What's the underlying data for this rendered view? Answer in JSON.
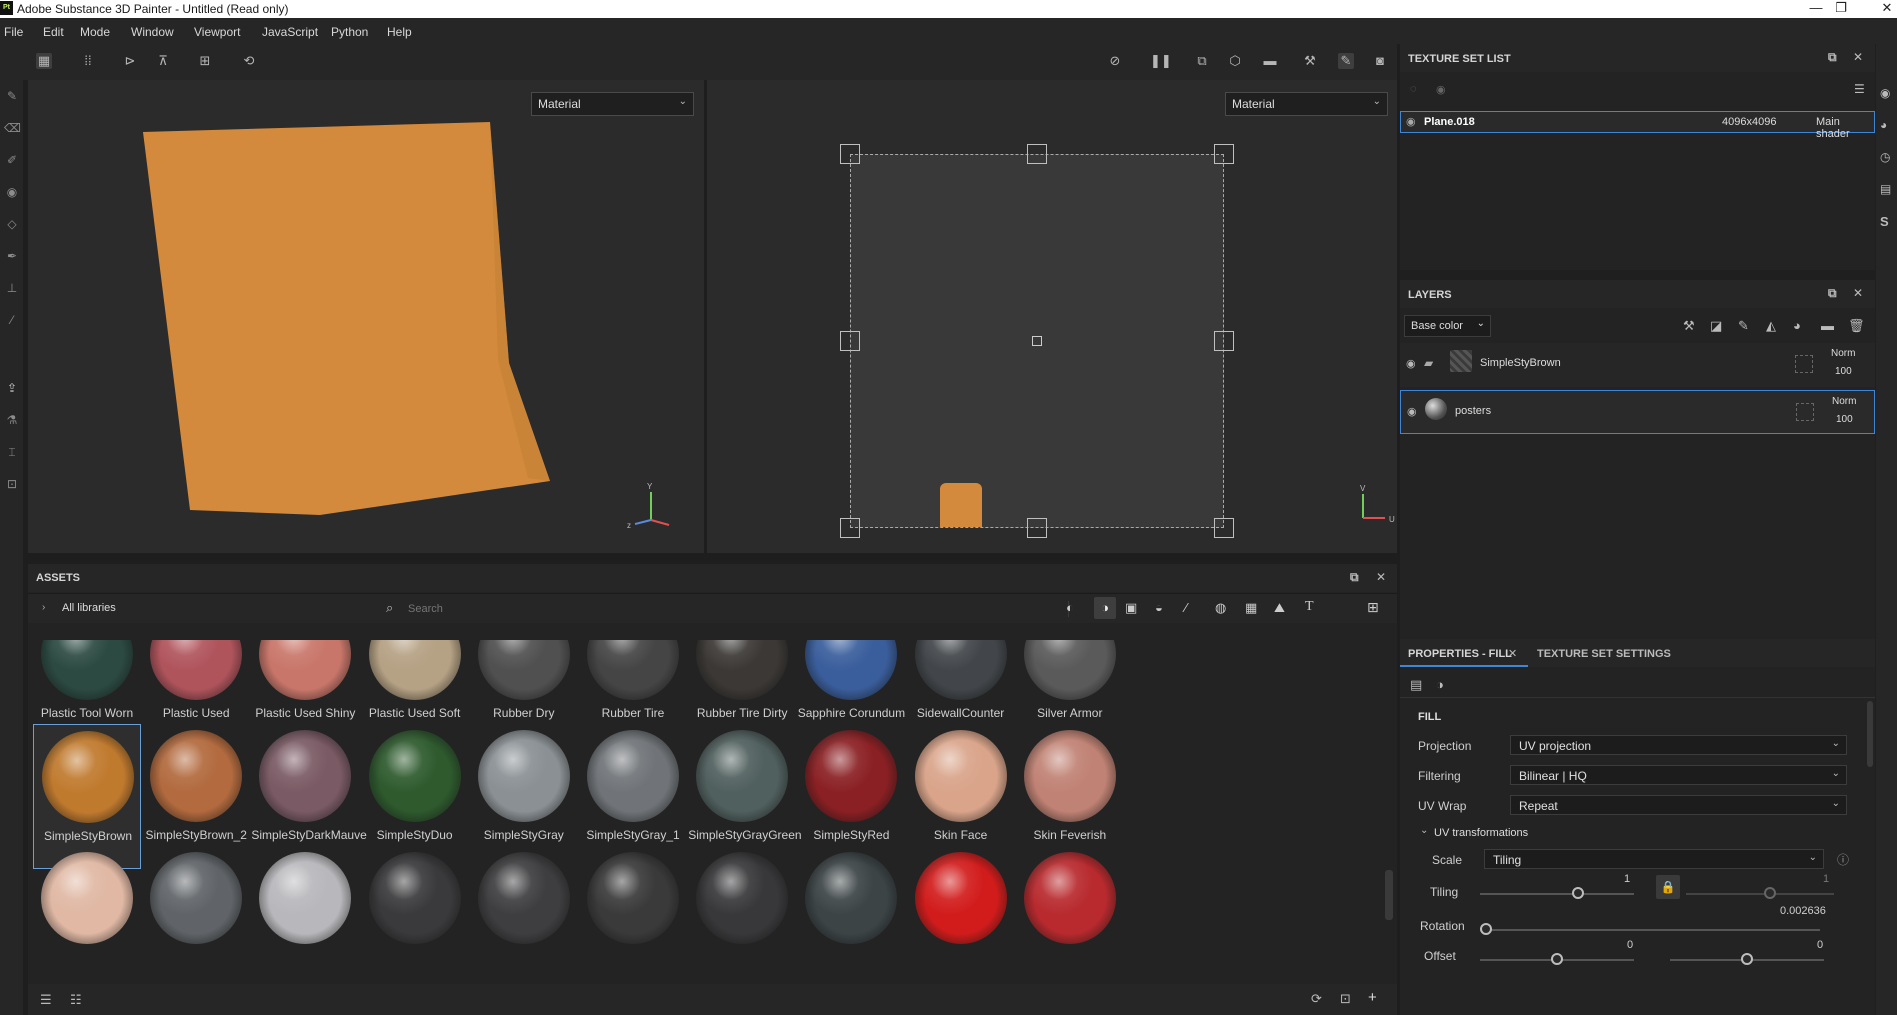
{
  "window": {
    "title": "Adobe Substance 3D Painter - Untitled (Read only)",
    "logo": "Pt"
  },
  "menu": [
    "File",
    "Edit",
    "Mode",
    "Window",
    "Viewport",
    "JavaScript",
    "Python",
    "Help"
  ],
  "viewport3d": {
    "mode": "Material",
    "gizmo_x": "z",
    "gizmo_y": "Y"
  },
  "viewport2d": {
    "mode": "Material",
    "gizmo_y": "V",
    "gizmo_u": "U"
  },
  "assets": {
    "title": "ASSETS",
    "library": "All libraries",
    "search_placeholder": "Search",
    "row1": [
      "Plastic Tool Worn",
      "Plastic Used",
      "Plastic Used Shiny",
      "Plastic Used Soft",
      "Rubber Dry",
      "Rubber Tire",
      "Rubber Tire Dirty",
      "Sapphire Corundum",
      "SidewallCounter",
      "Silver Armor"
    ],
    "row2": [
      "SimpleStyBrown",
      "SimpleStyBrown_2",
      "SimpleStyDarkMauve",
      "SimpleStyDuo",
      "SimpleStyGray",
      "SimpleStyGray_1",
      "SimpleStyGrayGreen",
      "SimpleStyRed",
      "Skin Face",
      "Skin Feverish"
    ],
    "colors1": [
      "#2c4a42",
      "#b0545c",
      "#c9766a",
      "#b5a184",
      "#505050",
      "#454545",
      "#3b3835",
      "#3a5e9c",
      "#42464a",
      "#5a5a5a"
    ],
    "colors2": [
      "#c07a2e",
      "#b26a3e",
      "#7a5a64",
      "#2e5a2e",
      "#8a9094",
      "#707478",
      "#50605e",
      "#8a2024",
      "#d9a48a",
      "#c08274"
    ],
    "colors3": [
      "#e0b8a4",
      "#606468",
      "#b8b8bc",
      "#3a3a3c",
      "#3e3e40",
      "#3a3a3a",
      "#38383a",
      "#3c4446",
      "#d21c1c",
      "#b82a2e"
    ]
  },
  "texture_set_list": {
    "title": "TEXTURE SET LIST",
    "item": {
      "name": "Plane.018",
      "size": "4096x4096",
      "shader": "Main shader"
    }
  },
  "layers": {
    "title": "LAYERS",
    "channel": "Base color",
    "items": [
      {
        "name": "SimpleStyBrown",
        "blend": "Norm",
        "opacity": "100"
      },
      {
        "name": "posters",
        "blend": "Norm",
        "opacity": "100"
      }
    ]
  },
  "properties": {
    "tab_active": "PROPERTIES - FILL",
    "tab_other": "TEXTURE SET SETTINGS",
    "section": "FILL",
    "projection": {
      "label": "Projection",
      "value": "UV projection"
    },
    "filtering": {
      "label": "Filtering",
      "value": "Bilinear | HQ"
    },
    "uvwrap": {
      "label": "UV Wrap",
      "value": "Repeat"
    },
    "uvtrans": "UV transformations",
    "scale": {
      "label": "Scale",
      "value": "Tiling"
    },
    "tiling": {
      "label": "Tiling",
      "value": "1",
      "value2": "1"
    },
    "rotation": {
      "label": "Rotation",
      "value": "0.002636"
    },
    "offset": {
      "label": "Offset",
      "value": "0",
      "value2": "0"
    }
  }
}
